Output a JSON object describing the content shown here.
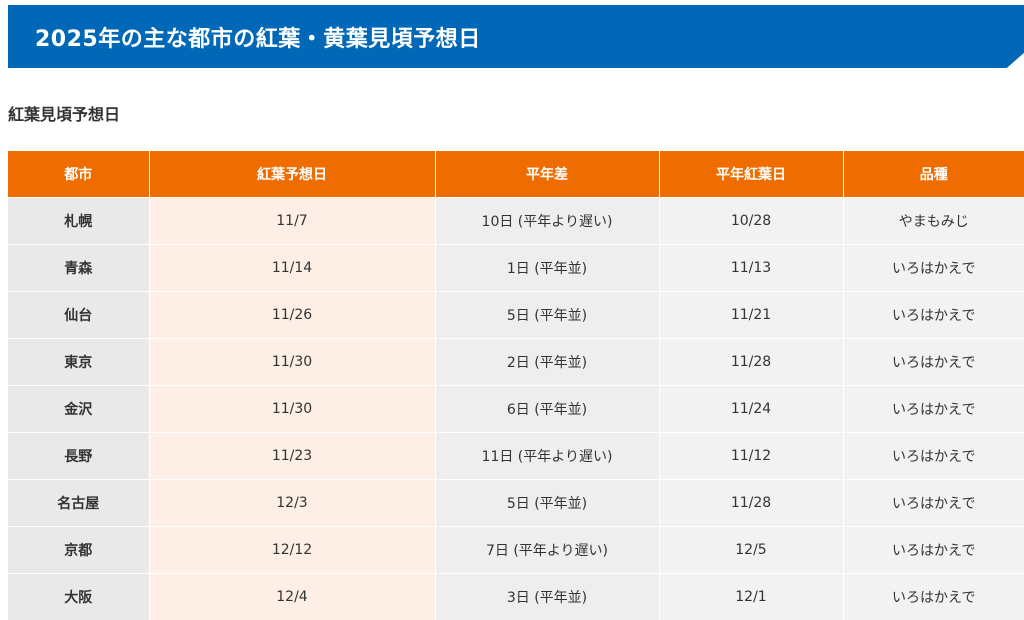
{
  "banner": {
    "title": "2025年の主な都市の紅葉・黄葉見頃予想日"
  },
  "section": {
    "subtitle": "紅葉見頃予想日"
  },
  "table": {
    "headers": [
      "都市",
      "紅葉予想日",
      "平年差",
      "平年紅葉日",
      "品種"
    ],
    "rows": [
      [
        "札幌",
        "11/7",
        "10日 (平年より遅い)",
        "10/28",
        "やまもみじ"
      ],
      [
        "青森",
        "11/14",
        "1日 (平年並)",
        "11/13",
        "いろはかえで"
      ],
      [
        "仙台",
        "11/26",
        "5日 (平年並)",
        "11/21",
        "いろはかえで"
      ],
      [
        "東京",
        "11/30",
        "2日 (平年並)",
        "11/28",
        "いろはかえで"
      ],
      [
        "金沢",
        "11/30",
        "6日 (平年並)",
        "11/24",
        "いろはかえで"
      ],
      [
        "長野",
        "11/23",
        "11日 (平年より遅い)",
        "11/12",
        "いろはかえで"
      ],
      [
        "名古屋",
        "12/3",
        "5日 (平年並)",
        "11/28",
        "いろはかえで"
      ],
      [
        "京都",
        "12/12",
        "7日 (平年より遅い)",
        "12/5",
        "いろはかえで"
      ],
      [
        "大阪",
        "12/4",
        "3日 (平年並)",
        "12/1",
        "いろはかえで"
      ]
    ]
  },
  "colors": {
    "banner": "#0068b7",
    "header": "#ef6c00",
    "forecast_column": "#fdeee6"
  }
}
